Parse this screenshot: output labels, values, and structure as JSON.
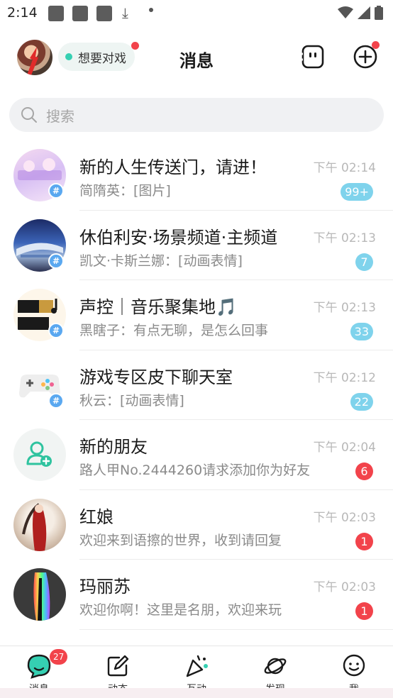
{
  "status_bar": {
    "time": "2:14"
  },
  "header": {
    "status_label": "想要对戏",
    "title": "消息"
  },
  "search": {
    "placeholder": "搜索"
  },
  "conversations": [
    {
      "name": "新的人生传送门，请进！",
      "preview": "简隋英：[图片]",
      "time": "下午 02:14",
      "badge": "99+",
      "badge_color": "#7fd3ec",
      "is_group": true,
      "avatar": "group-banner"
    },
    {
      "name": "休伯利安·场景频道·主频道",
      "preview": "凯文·卡斯兰娜：[动画表情]",
      "time": "下午 02:13",
      "badge": "7",
      "badge_color": "#7fd3ec",
      "is_group": true,
      "avatar": "ship"
    },
    {
      "name": "声控｜音乐聚集地🎵",
      "preview": "黑瞎子：有点无聊，是怎么回事",
      "time": "下午 02:13",
      "badge": "33",
      "badge_color": "#7fd3ec",
      "is_group": true,
      "avatar": "music"
    },
    {
      "name": "游戏专区皮下聊天室",
      "preview": "秋云：[动画表情]",
      "time": "下午 02:12",
      "badge": "22",
      "badge_color": "#7fd3ec",
      "is_group": true,
      "avatar": "gamepad"
    },
    {
      "name": "新的朋友",
      "preview": "路人甲No.2444260请求添加你为好友",
      "time": "下午 02:04",
      "badge": "6",
      "badge_color": "#f2434b",
      "is_group": false,
      "avatar": "add-friend"
    },
    {
      "name": "红娘",
      "preview": "欢迎来到语擦的世界，收到请回复",
      "time": "下午 02:03",
      "badge": "1",
      "badge_color": "#f2434b",
      "is_group": false,
      "avatar": "red-lady"
    },
    {
      "name": "玛丽苏",
      "preview": "欢迎你啊！这里是名朋，欢迎来玩",
      "time": "下午 02:03",
      "badge": "1",
      "badge_color": "#f2434b",
      "is_group": false,
      "avatar": "rainbow-hair"
    }
  ],
  "bottom_nav": {
    "items": [
      {
        "label": "消息",
        "icon": "chat-bubble-icon",
        "badge": "27"
      },
      {
        "label": "动态",
        "icon": "edit-icon"
      },
      {
        "label": "互动",
        "icon": "party-popper-icon"
      },
      {
        "label": "发现",
        "icon": "planet-icon"
      },
      {
        "label": "我",
        "icon": "smile-face-icon"
      }
    ]
  },
  "colors": {
    "accent": "#35d0b2",
    "badge_red": "#f2434b",
    "badge_blue": "#7fd3ec",
    "group_tag": "#5aa8f0"
  }
}
